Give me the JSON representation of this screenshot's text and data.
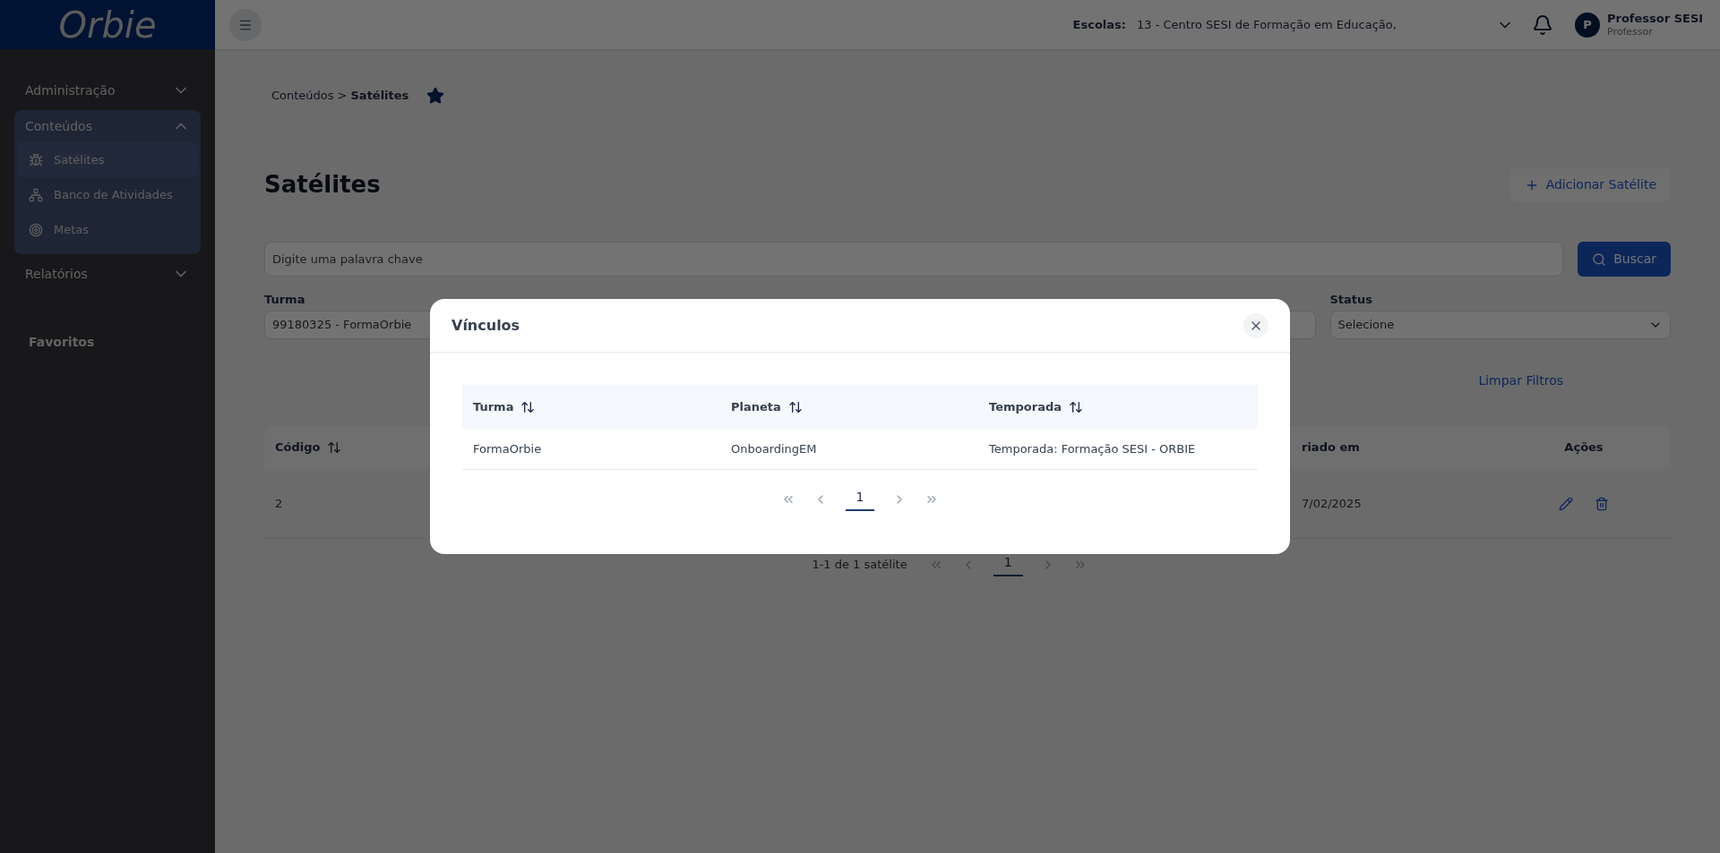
{
  "sidebar": {
    "logo": "Orbie",
    "menu": [
      {
        "label": "Administração",
        "expanded": false
      },
      {
        "label": "Conteúdos",
        "expanded": true,
        "children": [
          {
            "label": "Satélites",
            "selected": true
          },
          {
            "label": "Banco de Atividades",
            "selected": false
          },
          {
            "label": "Metas",
            "selected": false
          }
        ]
      },
      {
        "label": "Relatórios",
        "expanded": false
      }
    ],
    "favorites_heading": "Favoritos"
  },
  "header": {
    "school_label": "Escolas:",
    "school_value": "13 - Centro SESI de Formação em Educação,",
    "user": {
      "initial": "P",
      "name": "Professor SESI",
      "role": "Professor"
    }
  },
  "breadcrumb": {
    "items": [
      "Conteúdos",
      "Satélites"
    ],
    "separator": ">",
    "favorite": true
  },
  "title": "Satélites",
  "add_button": "Adicionar Satélite",
  "search": {
    "placeholder": "Digite uma palavra chave",
    "button": "Buscar"
  },
  "filters": [
    {
      "label": "Turma",
      "value": "99180325 - FormaOrbie"
    },
    {
      "label": "Status",
      "placeholder": "Selecione"
    }
  ],
  "clear_filters": "Limpar Filtros",
  "table": {
    "columns": [
      {
        "label": "Código",
        "sortable": true
      },
      {
        "label": "riado em",
        "sortable": false
      },
      {
        "label": "Ações",
        "sortable": false
      }
    ],
    "rows": [
      {
        "cells": [
          "2",
          "7/02/2025"
        ]
      }
    ]
  },
  "pagination": {
    "summary": "1-1 de 1 satélite",
    "pages": [
      {
        "label": "1",
        "selected": true
      }
    ]
  },
  "modal": {
    "title": "Vínculos",
    "columns": [
      {
        "label": "Turma",
        "sortable": true
      },
      {
        "label": "Planeta",
        "sortable": true
      },
      {
        "label": "Temporada",
        "sortable": true
      }
    ],
    "rows": [
      [
        "FormaOrbie",
        "OnboardingEM",
        "Temporada: Formação SESI - ORBIE"
      ]
    ],
    "pages": [
      {
        "label": "1",
        "selected": true
      }
    ]
  }
}
